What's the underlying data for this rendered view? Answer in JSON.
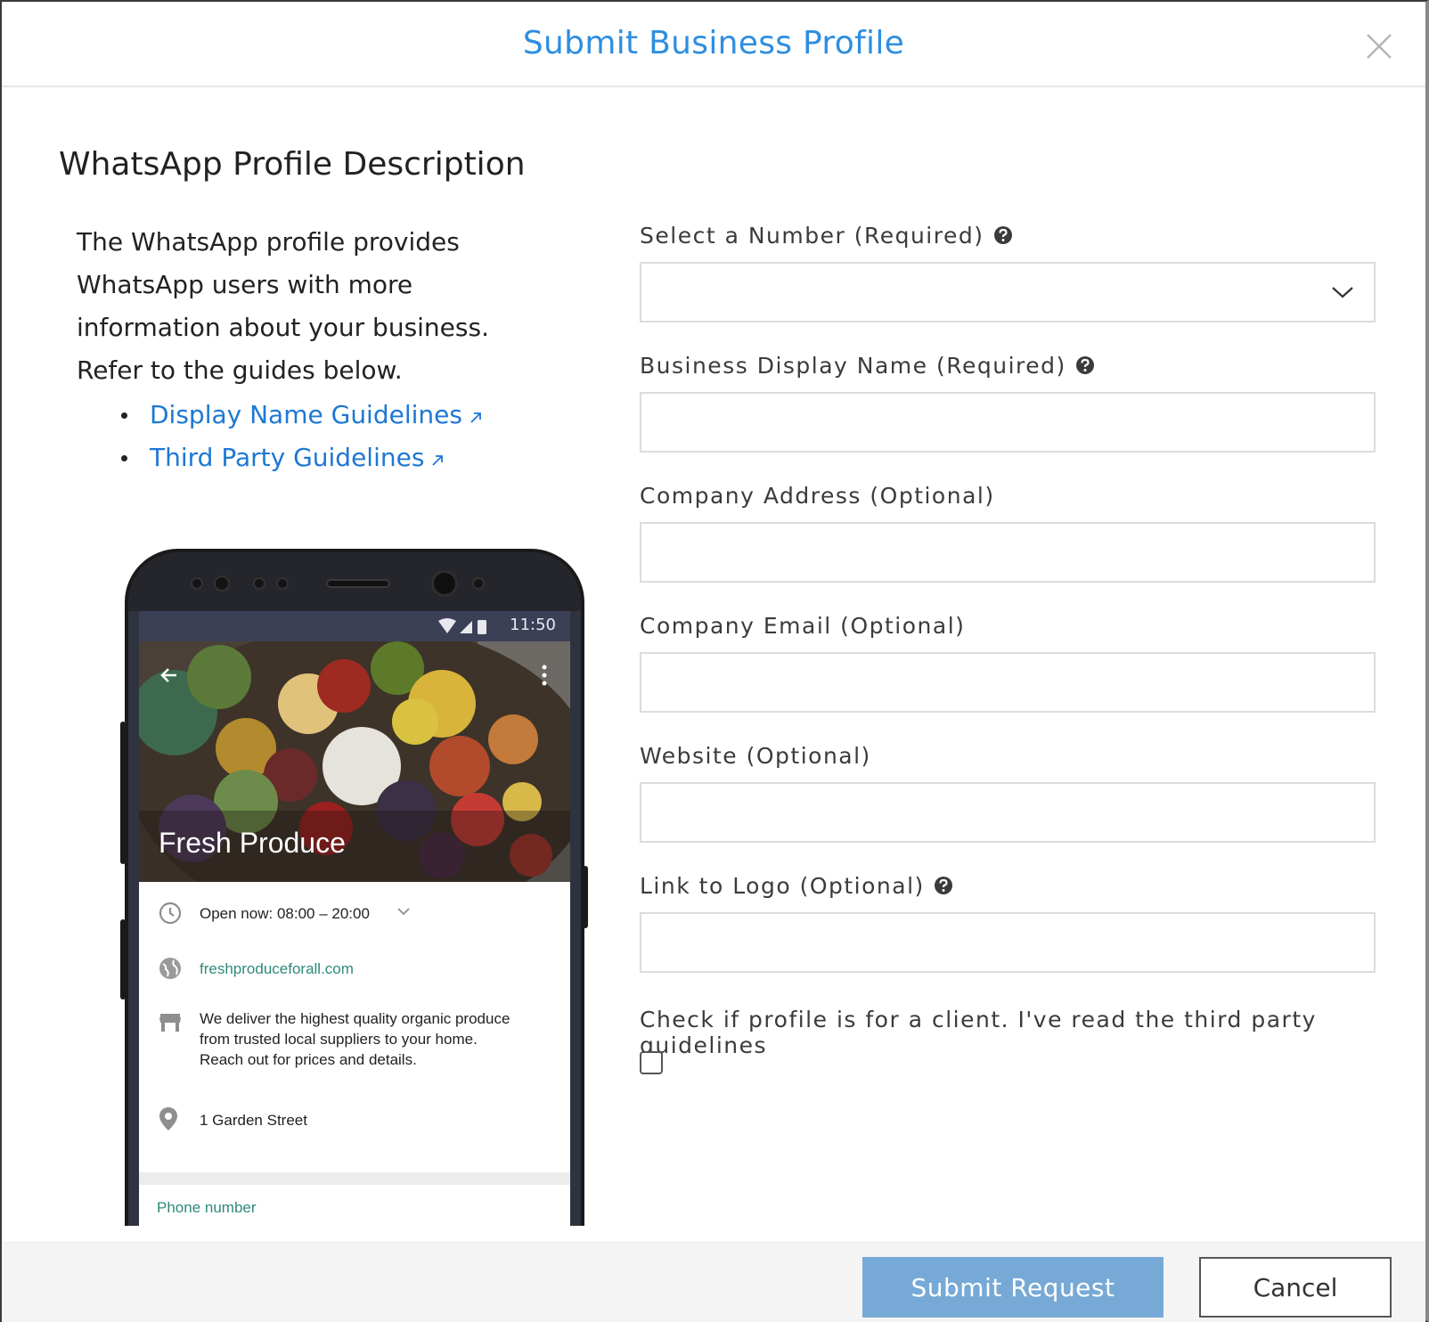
{
  "modal": {
    "title": "Submit Business Profile",
    "close_icon": "close-icon"
  },
  "section": {
    "title": "WhatsApp Profile Description"
  },
  "intro": {
    "lines": [
      "The WhatsApp profile provides",
      "WhatsApp users with more",
      "information about your business.",
      "Refer to the guides below."
    ],
    "guides": [
      {
        "label": "Display Name Guidelines",
        "icon": "external-link-icon"
      },
      {
        "label": "Third Party Guidelines",
        "icon": "external-link-icon"
      }
    ]
  },
  "phone_preview": {
    "status_time": "11:50",
    "business_name": "Fresh Produce",
    "hours": "Open now: 08:00 – 20:00",
    "website": "freshproduceforall.com",
    "description": [
      "We deliver the highest quality organic produce",
      "from trusted local suppliers to your home.",
      "Reach out for prices and details."
    ],
    "address": "1 Garden Street",
    "phone_label": "Phone number"
  },
  "form": {
    "number": {
      "label": "Select a Number (Required)",
      "value": ""
    },
    "display_name": {
      "label": "Business Display Name (Required)",
      "value": ""
    },
    "address": {
      "label": "Company Address (Optional)",
      "value": ""
    },
    "email": {
      "label": "Company Email (Optional)",
      "value": ""
    },
    "website": {
      "label": "Website (Optional)",
      "value": ""
    },
    "logo": {
      "label": "Link to Logo (Optional)",
      "value": ""
    },
    "client_check": {
      "label": "Check if profile is for a client. I've read the third party guidelines",
      "checked": false
    }
  },
  "footer": {
    "submit_label": "Submit Request",
    "cancel_label": "Cancel"
  },
  "colors": {
    "title_blue": "#2d8ee0",
    "link_blue": "#1d78d2",
    "submit_bg": "#77a9d6",
    "teal": "#2e8a7a"
  }
}
